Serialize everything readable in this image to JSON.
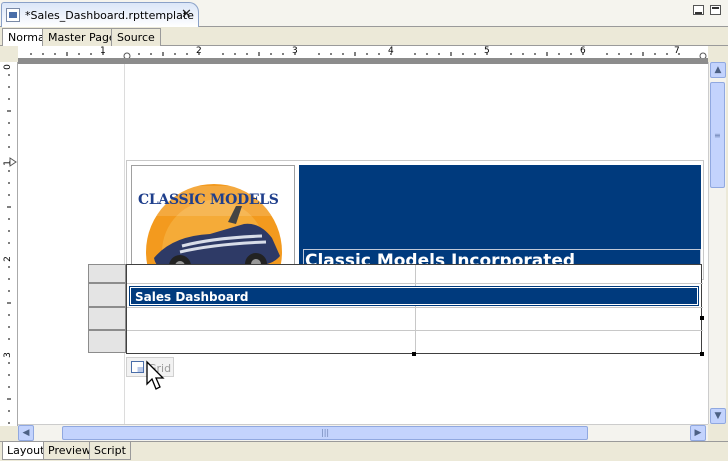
{
  "editor": {
    "tab_title": "*Sales_Dashboard.rpttemplate",
    "close_symbol": "✕"
  },
  "view_tabs": [
    "Normal",
    "Master Page",
    "Source"
  ],
  "ruler": {
    "horizontal_numbers": [
      "1",
      "2",
      "3",
      "4",
      "5",
      "6",
      "7"
    ],
    "vertical_numbers": [
      "0",
      "1",
      "2",
      "3"
    ]
  },
  "report": {
    "logo_text": "CLASSIC MODELS",
    "company_name": "Classic Models Incorporated",
    "dashboard_title": "Sales Dashboard",
    "grid_label": "Grid"
  },
  "bottom_tabs": [
    "Layout",
    "Preview",
    "Script"
  ],
  "colors": {
    "header_blue": "#003a7d",
    "logo_sun": "#f39a1e",
    "logo_text": "#1f3f8c"
  }
}
